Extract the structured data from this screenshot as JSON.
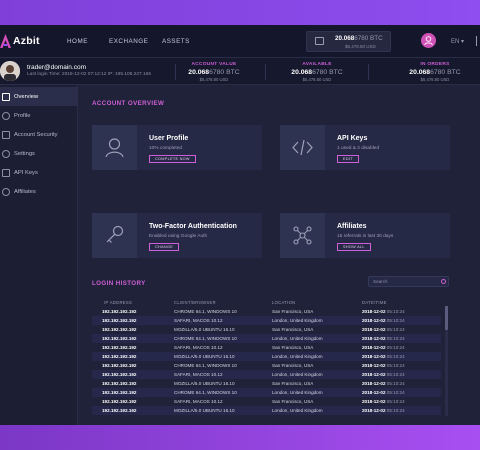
{
  "app": {
    "name": "Azbit"
  },
  "nav": {
    "links": [
      "HOME",
      "EXCHANGE",
      "ASSETS"
    ],
    "wallet_amount": "20.068",
    "wallet_amount_rest": "6780 BTC",
    "wallet_usd": "$5,478.80 USD",
    "language": "EN"
  },
  "account": {
    "email": "trader@domain.com",
    "last_login": "Last login Time: 2018-12-02 07:12:12     IP: 195.108.227.166",
    "stats": [
      {
        "label": "ACCOUNT VALUE",
        "value": "20.068",
        "value_rest": "6780 BTC",
        "sub": "$5,478.80 USD"
      },
      {
        "label": "AVAILABLE",
        "value": "20.068",
        "value_rest": "6780 BTC",
        "sub": "$5,478.80 USD"
      },
      {
        "label": "IN ORDERS",
        "value": "20.068",
        "value_rest": "6780 BTC",
        "sub": "$5,478.80 USD"
      }
    ]
  },
  "sidebar": {
    "items": [
      {
        "label": "Overview",
        "icon": "grid-icon"
      },
      {
        "label": "Profile",
        "icon": "user-icon"
      },
      {
        "label": "Account Security",
        "icon": "shield-icon"
      },
      {
        "label": "Settings",
        "icon": "gear-icon"
      },
      {
        "label": "API Keys",
        "icon": "code-icon"
      },
      {
        "label": "Affiliates",
        "icon": "network-icon"
      }
    ]
  },
  "overview": {
    "title": "ACCOUNT OVERVIEW",
    "cards": [
      {
        "title": "User Profile",
        "sub": "10% completed",
        "button": "COMPLETE NOW",
        "icon": "user-icon"
      },
      {
        "title": "API Keys",
        "sub": "1 used & 2 disabled",
        "button": "EDIT",
        "icon": "code-icon"
      },
      {
        "title": "Two-Factor Authentication",
        "sub": "Enabled using Google Auth",
        "button": "CHANGE",
        "icon": "key-icon"
      },
      {
        "title": "Affiliates",
        "sub": "15 referrals in last 30 days",
        "button": "SHOW ALL",
        "icon": "network-icon"
      }
    ]
  },
  "login_history": {
    "title": "LOGIN HISTORY",
    "search_placeholder": "Search",
    "columns": [
      "IP ADDRESS",
      "CLIENT/BROWSER",
      "LOCATION",
      "DATE/TIME"
    ],
    "rows": [
      [
        "192.192.192.192",
        "CHROME 64.1, WINDOWS 10",
        "San Francisco, USA",
        "2018-12-02",
        "05:10:24"
      ],
      [
        "192.192.192.192",
        "SAFARI, MACOS 10.12",
        "London, United Kingdom",
        "2018-12-02",
        "05:10:24"
      ],
      [
        "192.192.192.192",
        "MOZILLA/5.0 UBUNTU 16.10",
        "San Francisco, USA",
        "2018-12-02",
        "05:10:24"
      ],
      [
        "192.192.192.192",
        "CHROME 64.1, WINDOWS 10",
        "London, United Kingdom",
        "2018-12-02",
        "05:10:24"
      ],
      [
        "192.192.192.192",
        "SAFARI, MACOS 10.12",
        "San Francisco, USA",
        "2018-12-02",
        "05:10:24"
      ],
      [
        "192.192.192.192",
        "MOZILLA/5.0 UBUNTU 16.10",
        "London, United Kingdom",
        "2018-12-02",
        "05:10:24"
      ],
      [
        "192.192.192.192",
        "CHROME 64.1, WINDOWS 10",
        "San Francisco, USA",
        "2018-12-02",
        "05:10:24"
      ],
      [
        "192.192.192.192",
        "SAFARI, MACOS 10.12",
        "London, United Kingdom",
        "2018-12-02",
        "05:10:24"
      ],
      [
        "192.192.192.192",
        "MOZILLA/5.0 UBUNTU 16.10",
        "San Francisco, USA",
        "2018-12-02",
        "05:10:24"
      ],
      [
        "192.192.192.192",
        "CHROME 64.1, WINDOWS 10",
        "London, United Kingdom",
        "2018-12-02",
        "05:10:24"
      ],
      [
        "192.192.192.192",
        "SAFARI, MACOS 10.12",
        "San Francisco, USA",
        "2018-12-02",
        "05:10:24"
      ],
      [
        "192.192.192.192",
        "MOZILLA/5.0 UBUNTU 16.10",
        "London, United Kingdom",
        "2018-12-02",
        "05:10:24"
      ]
    ]
  },
  "colors": {
    "accent": "#cf5fd6",
    "background": "#1f2239",
    "brand_purple": "#8e4ef0"
  }
}
